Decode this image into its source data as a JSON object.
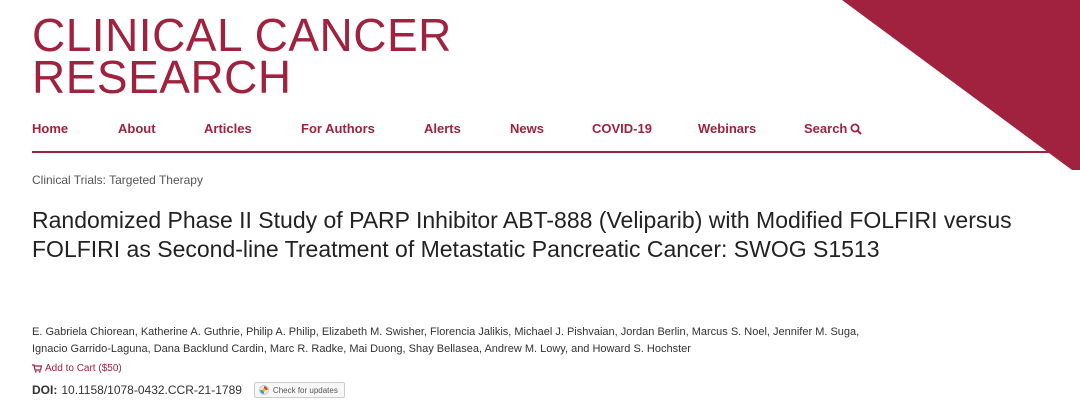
{
  "brand": {
    "line1": "CLINICAL CANCER",
    "line2": "RESEARCH",
    "color": "#a0223f"
  },
  "nav": {
    "items": [
      "Home",
      "About",
      "Articles",
      "For Authors",
      "Alerts",
      "News",
      "COVID-19",
      "Webinars",
      "Search"
    ],
    "search_icon": "magnifier-icon"
  },
  "article": {
    "category": "Clinical Trials: Targeted Therapy",
    "title": "Randomized Phase II Study of PARP Inhibitor ABT-888 (Veliparib) with Modified FOLFIRI versus FOLFIRI as Second-line Treatment of Metastatic Pancreatic Cancer: SWOG S1513",
    "authors_line1": "E. Gabriela Chiorean, Katherine A. Guthrie, Philip A. Philip, Elizabeth M. Swisher, Florencia Jalikis, Michael J. Pishvaian, Jordan Berlin, Marcus S. Noel, Jennifer M. Suga,",
    "authors_line2": "Ignacio Garrido-Laguna, Dana Backlund Cardin, Marc R. Radke, Mai Duong, Shay Bellasea, Andrew M. Lowy, and Howard S. Hochster",
    "add_to_cart": "Add to Cart ($50)",
    "doi_label": "DOI:",
    "doi_value": "10.1158/1078-0432.CCR-21-1789",
    "check_updates": "Check for updates"
  }
}
